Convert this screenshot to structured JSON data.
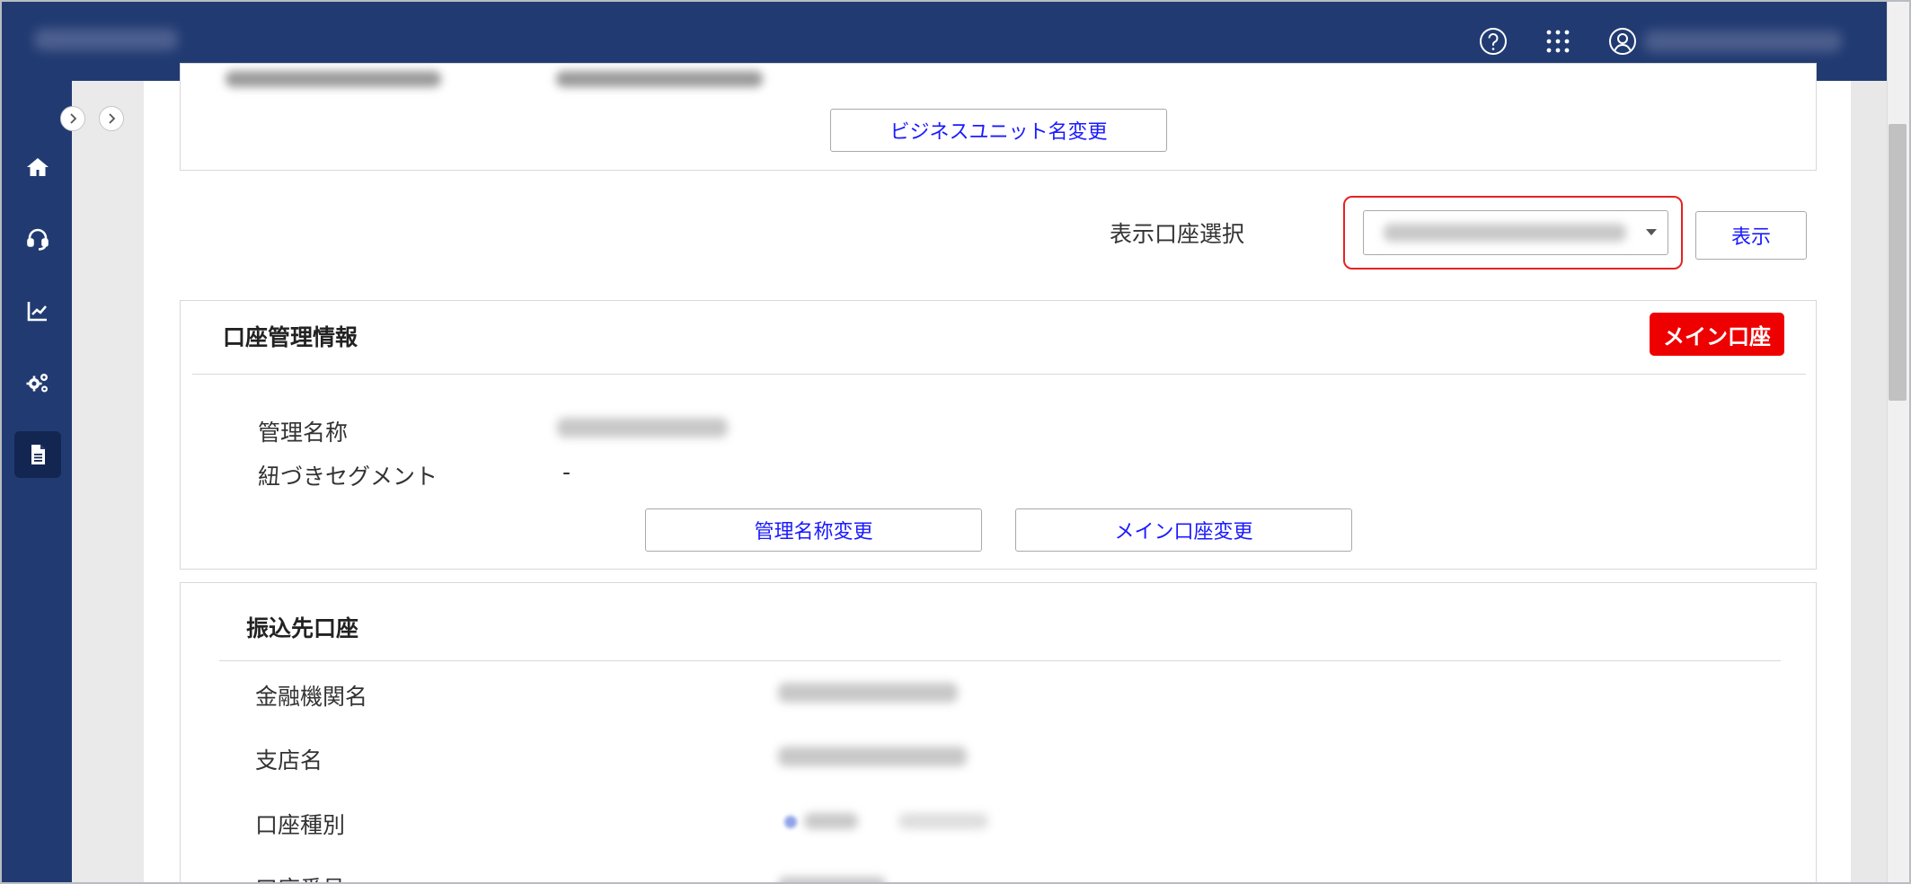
{
  "header": {
    "icons": [
      "help-icon",
      "apps-grid-icon",
      "user-icon"
    ],
    "colors": {
      "bar": "#213b72",
      "accent_text": "#1a1aff",
      "badge": "#ee0000",
      "highlight": "#e52222"
    }
  },
  "sidebar": {
    "items": [
      {
        "icon": "home-icon"
      },
      {
        "icon": "headset-icon"
      },
      {
        "icon": "chart-icon"
      },
      {
        "icon": "settings-gears-icon"
      },
      {
        "icon": "document-icon",
        "active": true
      }
    ]
  },
  "business_unit": {
    "change_button": "ビジネスユニット名変更"
  },
  "account_select": {
    "label": "表示口座選択",
    "show_button": "表示"
  },
  "account_mgmt": {
    "title": "口座管理情報",
    "badge": "メイン口座",
    "fields": [
      {
        "label": "管理名称"
      },
      {
        "label": "紐づきセグメント",
        "value": "-"
      }
    ],
    "buttons": {
      "rename": "管理名称変更",
      "change_main": "メイン口座変更"
    }
  },
  "transfer_account": {
    "title": "振込先口座",
    "fields": [
      {
        "label": "金融機関名"
      },
      {
        "label": "支店名"
      },
      {
        "label": "口座種別"
      },
      {
        "label": "口座番号"
      }
    ]
  }
}
